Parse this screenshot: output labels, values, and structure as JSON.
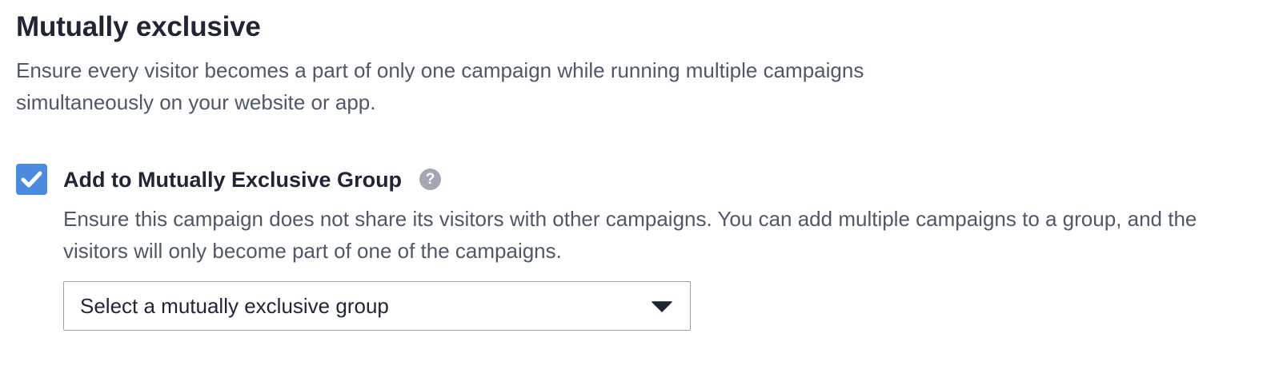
{
  "section": {
    "title": "Mutually exclusive",
    "description": "Ensure every visitor becomes a part of only one campaign while running multiple campaigns simultaneously on your website or app."
  },
  "option": {
    "checked": true,
    "label": "Add to Mutually Exclusive Group",
    "help_icon_glyph": "?",
    "description": "Ensure this campaign does not share its visitors with other campaigns. You can add multiple campaigns to a group, and the visitors will only become part of one of the campaigns."
  },
  "group_select": {
    "selected_text": "Select a mutually exclusive group",
    "icon": "caret-down-icon"
  },
  "colors": {
    "checkbox_fill": "#4a8bdf",
    "help_icon": "#a2a8b3",
    "heading_text": "#1f2533",
    "body_text": "#4f5867",
    "select_border": "#9aa1ad"
  },
  "icons": {
    "checkbox": "checkmark-icon",
    "help": "question-circle-icon",
    "dropdown": "caret-down-icon"
  }
}
